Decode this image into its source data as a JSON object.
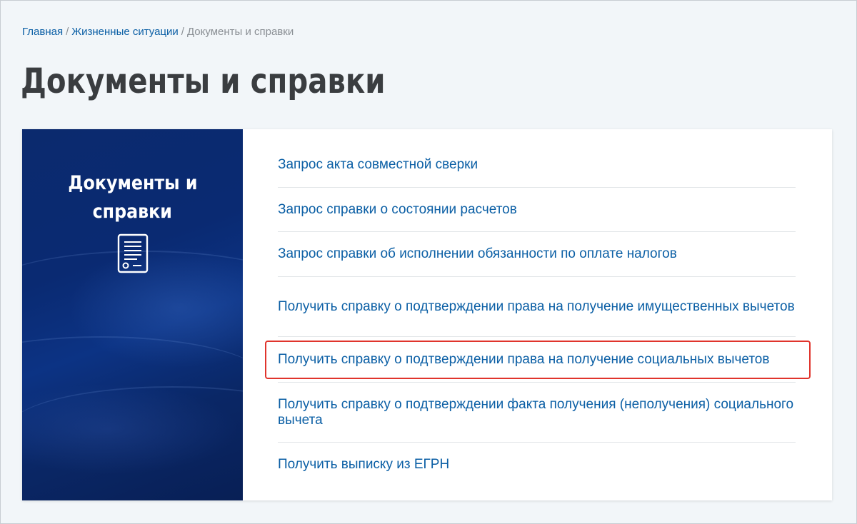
{
  "breadcrumb": {
    "home": "Главная",
    "life_situations": "Жизненные ситуации",
    "current": "Документы и справки",
    "separator": "/"
  },
  "page_title": "Документы и справки",
  "banner": {
    "title_line1": "Документы и",
    "title_line2": "справки",
    "icon": "document-icon"
  },
  "links": [
    {
      "label": "Запрос акта совместной сверки"
    },
    {
      "label": "Запрос справки о состоянии расчетов"
    },
    {
      "label": "Запрос справки об исполнении обязанности по оплате налогов"
    },
    {
      "label": "Получить справку о подтверждении права на получение имущественных вычетов"
    },
    {
      "label": "Получить справку о подтверждении права на получение социальных вычетов",
      "highlighted": true
    },
    {
      "label": "Получить справку о подтверждении факта получения (неполучения) социального вычета"
    },
    {
      "label": "Получить выписку из ЕГРН"
    }
  ],
  "colors": {
    "link": "#0b5fa5",
    "title": "#3a3d40",
    "banner": "#0a2a72",
    "highlight_border": "#e0342c"
  }
}
